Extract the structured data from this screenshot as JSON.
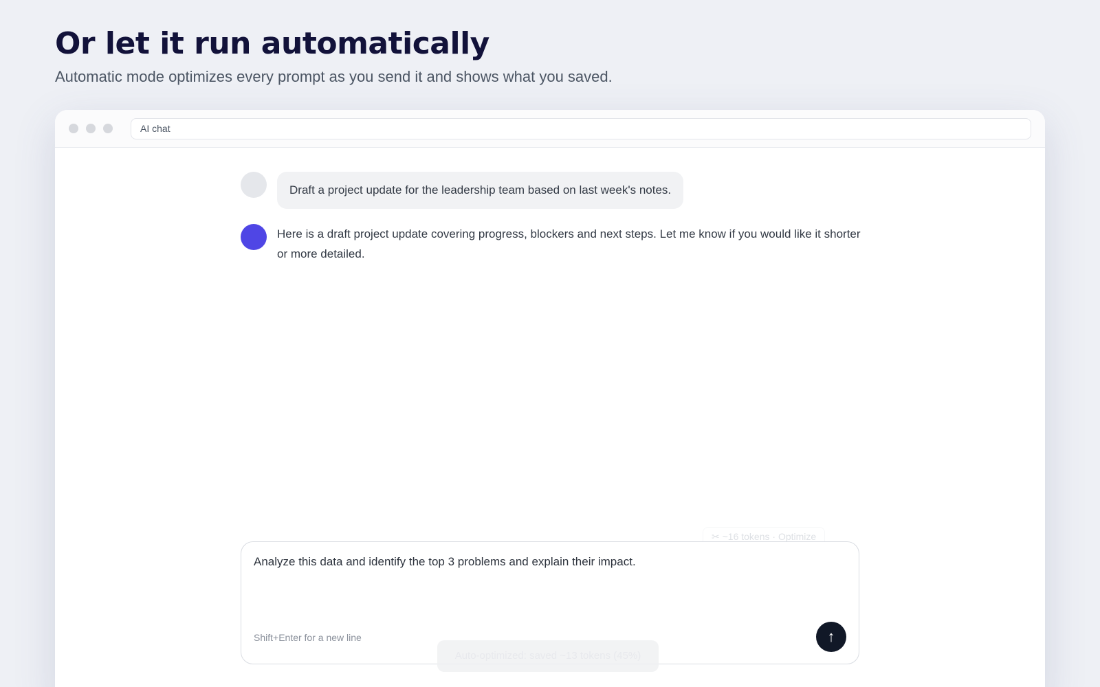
{
  "hero": {
    "title": "Or let it run automatically",
    "subtitle": "Automatic mode optimizes every prompt as you send it and shows what you saved."
  },
  "window": {
    "address_text": "AI chat"
  },
  "messages": [
    {
      "role": "user",
      "text": "Draft a project update for the leadership team based on last week's notes."
    },
    {
      "role": "assistant",
      "text": "Here is a draft project update covering progress, blockers and next steps. Let me know if you would like it shorter or more detailed."
    }
  ],
  "optimize_chip": {
    "icon": "scissors-icon",
    "text": "✂ ~16 tokens · Optimize"
  },
  "composer": {
    "value": "Analyze this data and identify the top 3 problems and explain their impact.",
    "hint": "Shift+Enter for a new line",
    "send_icon": "↑"
  },
  "toast": {
    "text": "Auto-optimized: saved ~13 tokens (45%)"
  }
}
